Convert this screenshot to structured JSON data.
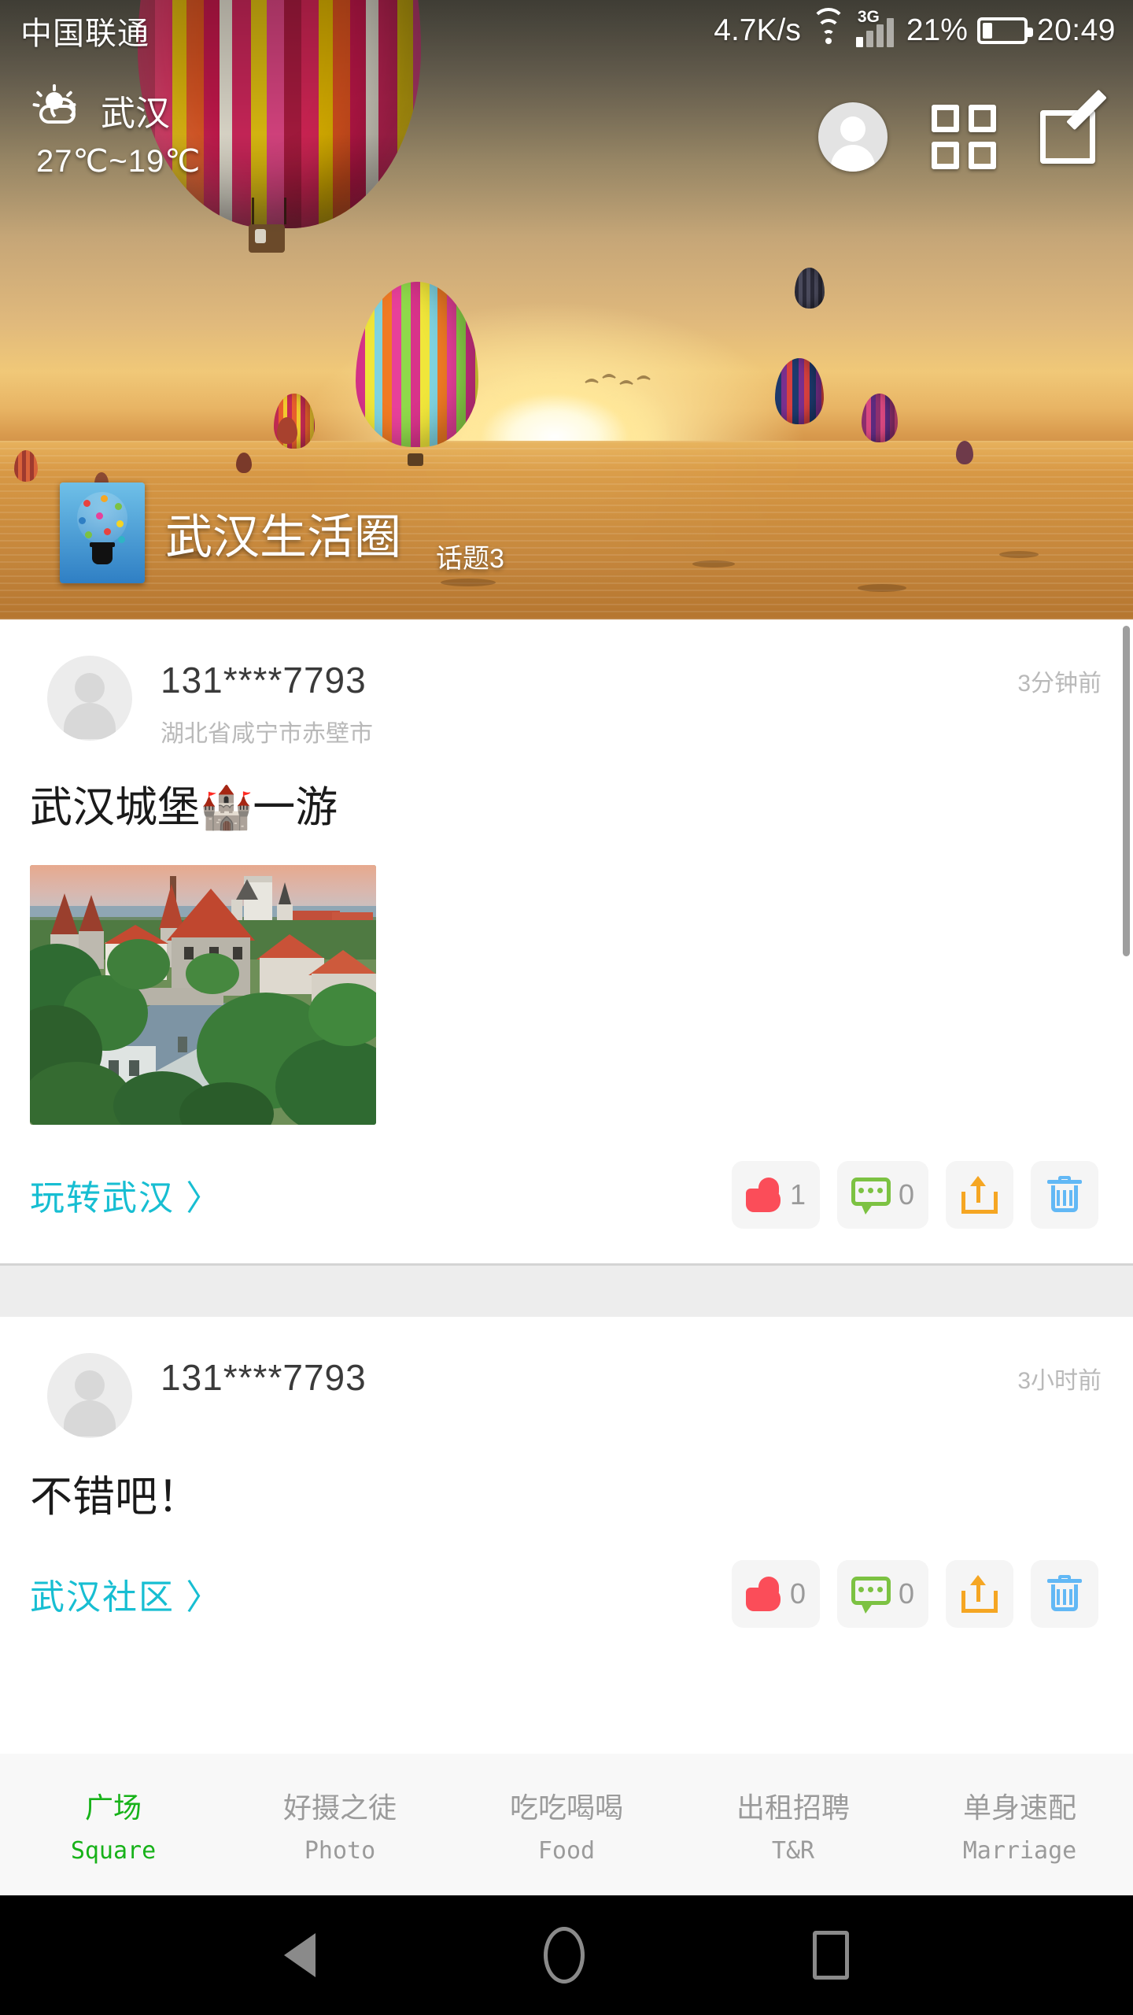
{
  "statusbar": {
    "carrier": "中国联通",
    "netspeed": "4.7K/s",
    "wifi_icon": "wifi-icon",
    "network_type": "3G",
    "battery_percent": "21%",
    "clock": "20:49"
  },
  "weather": {
    "icon": "sun-behind-cloud-icon",
    "city": "武汉",
    "temperature": "27℃~19℃"
  },
  "header": {
    "avatar_icon": "user-avatar-icon",
    "grid_icon": "grid-menu-icon",
    "compose_icon": "compose-edit-icon",
    "group_name": "武汉生活圈",
    "group_topic": "话题3",
    "group_logo": "lightbulb-network-logo"
  },
  "posts": [
    {
      "avatar": "default-user-avatar",
      "name": "131****7793",
      "location": "湖北省咸宁市赤壁市",
      "time": "3分钟前",
      "text": "武汉城堡🏰一游",
      "has_photo": true,
      "photo_alt": "castle-town-photo",
      "link": "玩转武汉 〉",
      "like_icon": "thumbs-up-icon",
      "like_count": "1",
      "comment_icon": "comment-bubble-icon",
      "comment_count": "0",
      "share_icon": "share-icon",
      "delete_icon": "trash-icon"
    },
    {
      "avatar": "default-user-avatar",
      "name": "131****7793",
      "location": "",
      "time": "3小时前",
      "text": "不错吧！",
      "has_photo": false,
      "photo_alt": "",
      "link": "武汉社区 〉",
      "like_icon": "thumbs-up-icon",
      "like_count": "0",
      "comment_icon": "comment-bubble-icon",
      "comment_count": "0",
      "share_icon": "share-icon",
      "delete_icon": "trash-icon"
    }
  ],
  "tabbar": {
    "items": [
      {
        "cn": "广场",
        "en": "Square",
        "active": true
      },
      {
        "cn": "好摄之徒",
        "en": "Photo",
        "active": false
      },
      {
        "cn": "吃吃喝喝",
        "en": "Food",
        "active": false
      },
      {
        "cn": "出租招聘",
        "en": "T&R",
        "active": false
      },
      {
        "cn": "单身速配",
        "en": "Marriage",
        "active": false
      }
    ],
    "active_color": "#17b219",
    "inactive_color": "#9b9b9b"
  },
  "navbar": {
    "back_icon": "back-triangle-icon",
    "home_icon": "home-circle-icon",
    "recents_icon": "recents-square-icon"
  },
  "colors": {
    "link_cyan": "#17bed2",
    "like_red": "#fb4d59",
    "comment_green": "#7cc242",
    "share_orange": "#f5a623",
    "trash_blue": "#62b8f5"
  }
}
